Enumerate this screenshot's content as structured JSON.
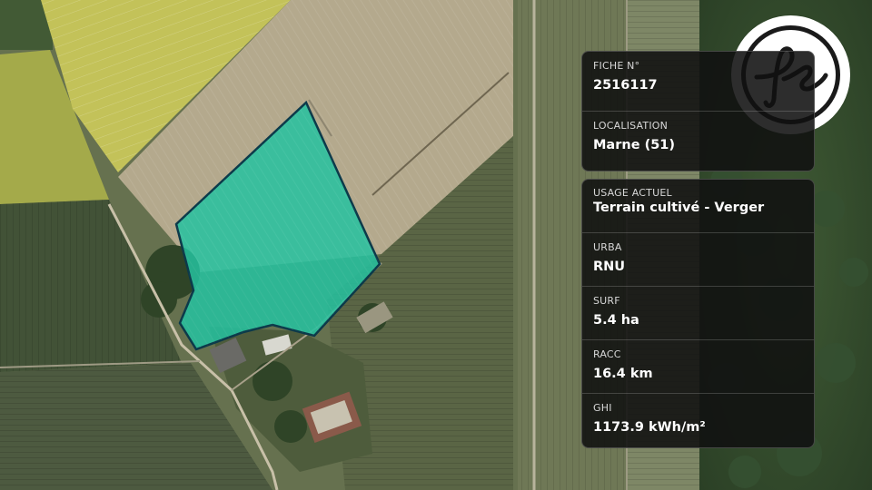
{
  "colors": {
    "parcel_fill": "#25c2a0",
    "parcel_stroke": "#0c3a4a",
    "rapeseed": "#c9c85a",
    "card_bg": "#111111",
    "logo_ink": "#1a1a1a"
  },
  "logo": {
    "icon": "fs-monogram-logo-icon",
    "text": "fs"
  },
  "fiche": {
    "number_label": "FICHE N°",
    "number_value": "2516117",
    "location_label": "LOCALISATION",
    "location_value": "Marne (51)"
  },
  "details": [
    {
      "label": "USAGE ACTUEL",
      "value": "Terrain cultivé - Verger"
    },
    {
      "label": "URBA",
      "value": "RNU"
    },
    {
      "label": "SURF",
      "value": "5.4 ha"
    },
    {
      "label": "RACC",
      "value": "16.4 km"
    },
    {
      "label": "GHI",
      "value": "1173.9 kWh/m²"
    }
  ]
}
